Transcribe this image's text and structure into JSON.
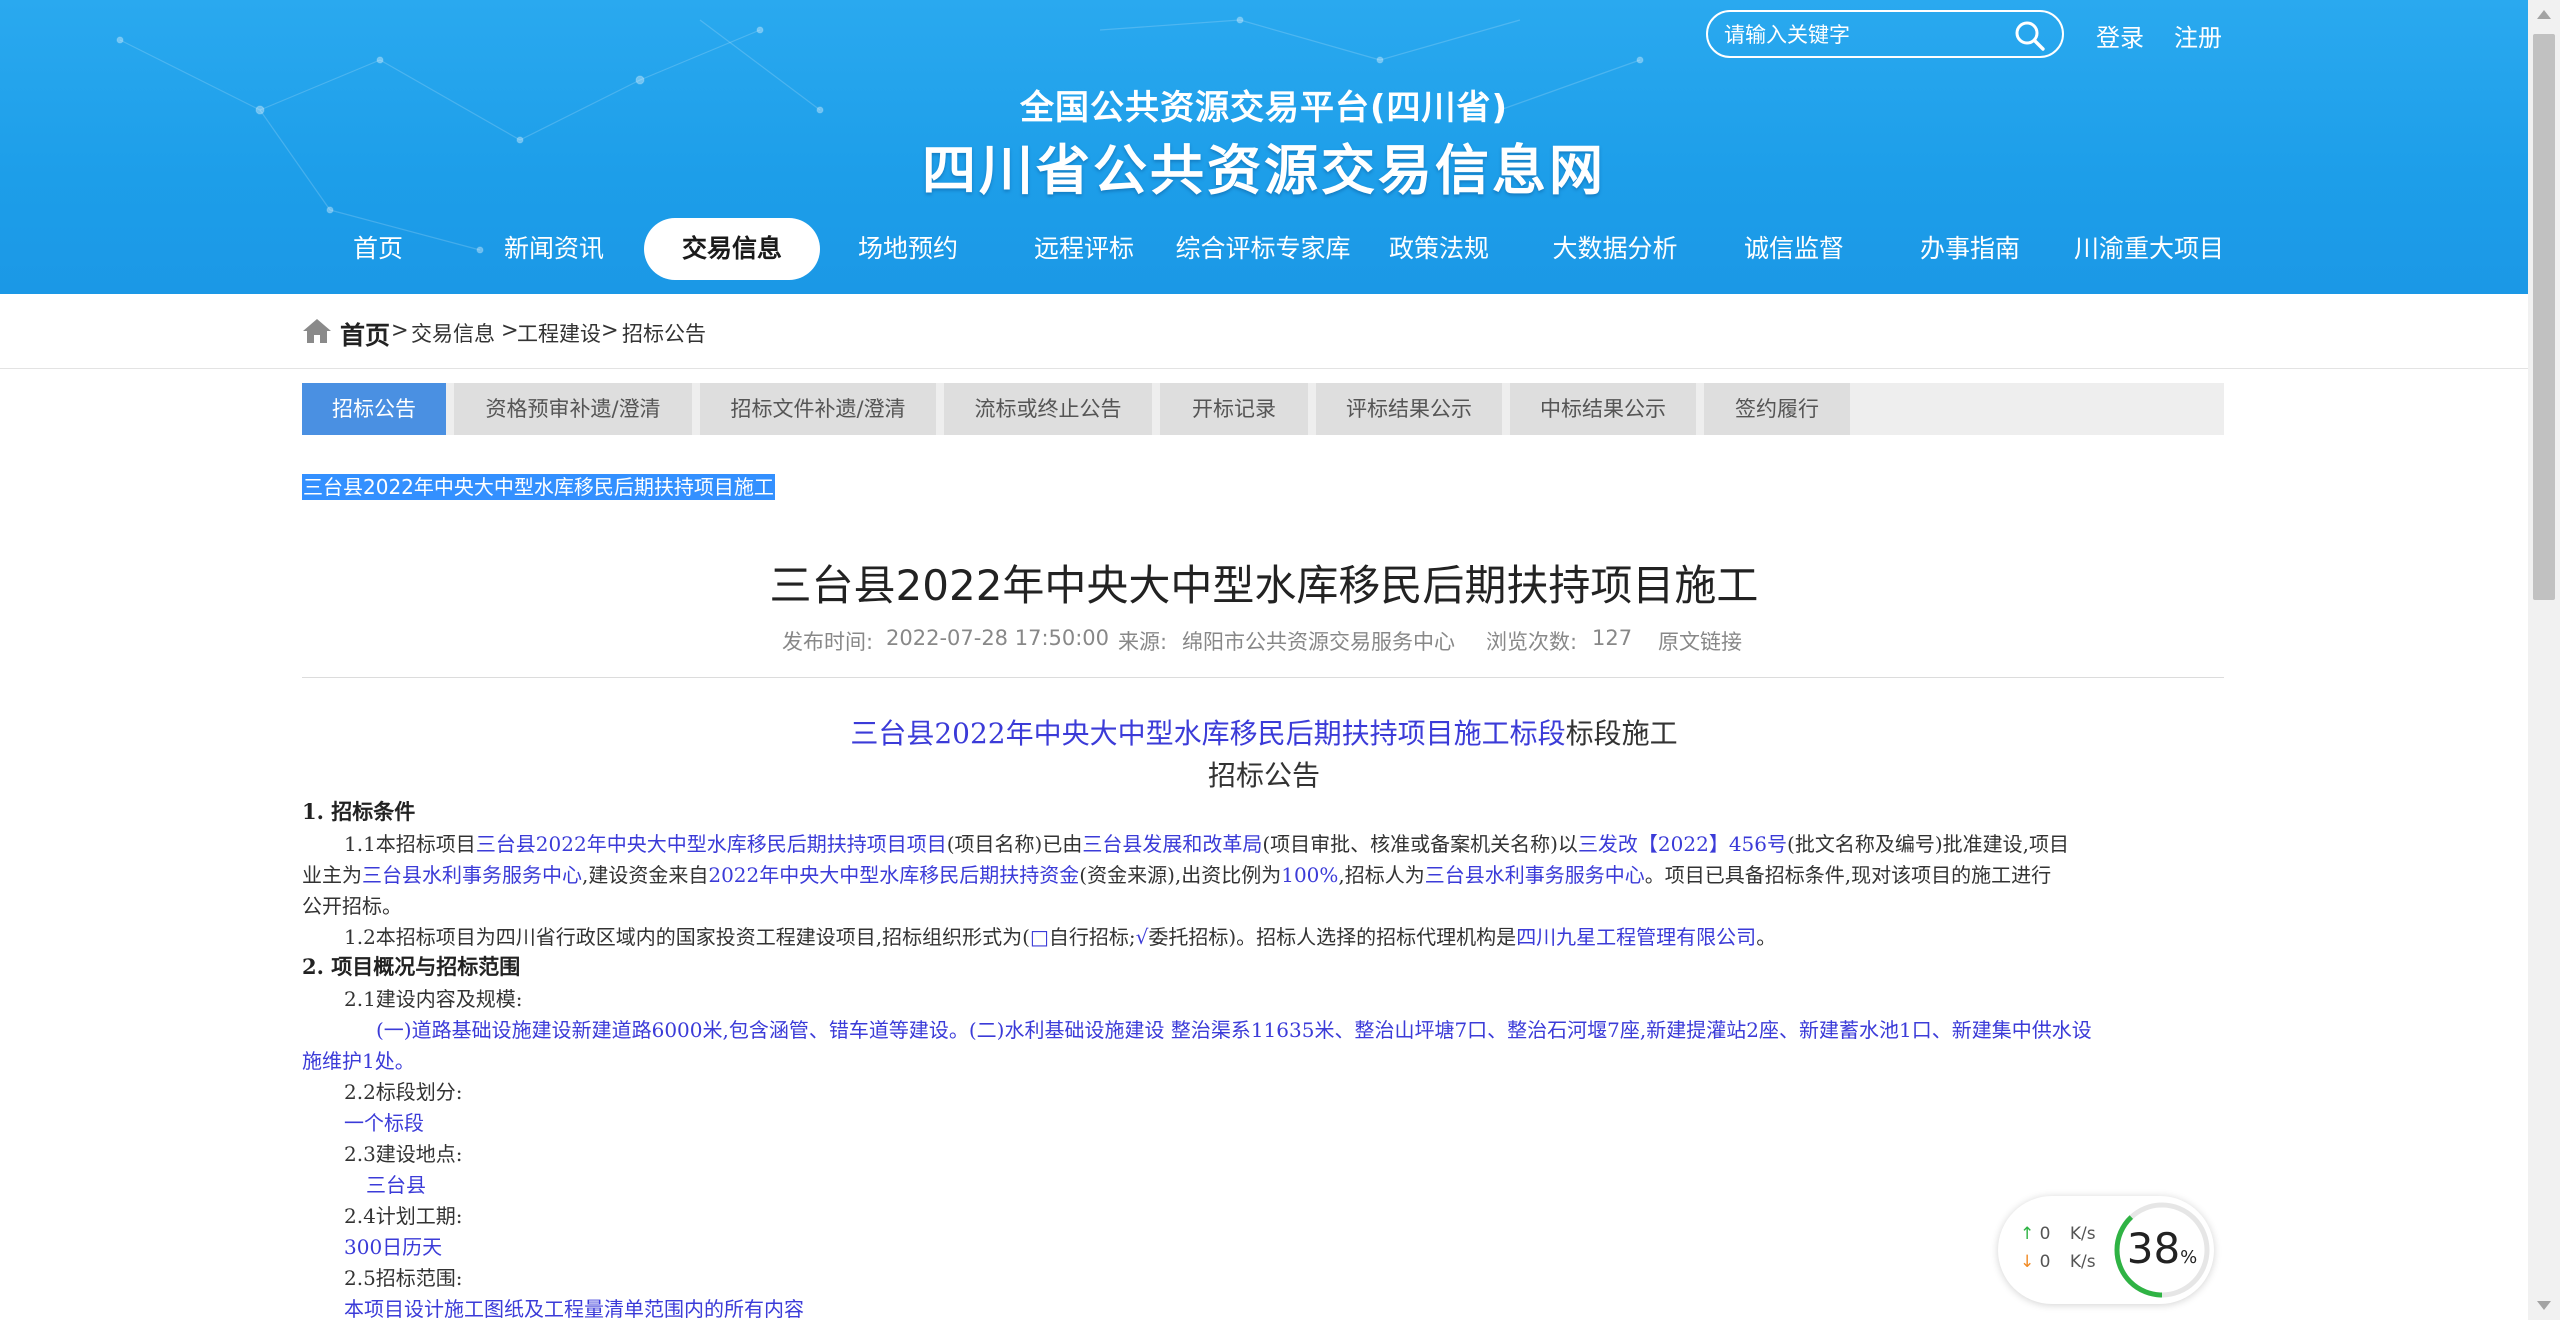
{
  "header": {
    "search": {
      "placeholder": "请输入关键字"
    },
    "login": "登录",
    "register": "注册",
    "subtitle": "全国公共资源交易平台(四川省)",
    "title": "四川省公共资源交易信息网"
  },
  "nav": {
    "items": [
      {
        "label": "首页",
        "active": false
      },
      {
        "label": "新闻资讯",
        "active": false
      },
      {
        "label": "交易信息",
        "active": true
      },
      {
        "label": "场地预约",
        "active": false
      },
      {
        "label": "远程评标",
        "active": false
      },
      {
        "label": "综合评标专家库",
        "active": false
      },
      {
        "label": "政策法规",
        "active": false
      },
      {
        "label": "大数据分析",
        "active": false
      },
      {
        "label": "诚信监督",
        "active": false
      },
      {
        "label": "办事指南",
        "active": false
      },
      {
        "label": "川渝重大项目",
        "active": false
      }
    ]
  },
  "breadcrumb": {
    "home": "首页",
    "sep": ">",
    "items": [
      "交易信息",
      "工程建设",
      "招标公告"
    ]
  },
  "tabs": {
    "items": [
      {
        "label": "招标公告",
        "active": true
      },
      {
        "label": "资格预审补遗/澄清",
        "active": false
      },
      {
        "label": "招标文件补遗/澄清",
        "active": false
      },
      {
        "label": "流标或终止公告",
        "active": false
      },
      {
        "label": "开标记录",
        "active": false
      },
      {
        "label": "评标结果公示",
        "active": false
      },
      {
        "label": "中标结果公示",
        "active": false
      },
      {
        "label": "签约履行",
        "active": false
      }
    ]
  },
  "article": {
    "highlight_title": "三台县2022年中央大中型水库移民后期扶持项目施工",
    "title": "三台县2022年中央大中型水库移民后期扶持项目施工",
    "meta": {
      "publish_label": "发布时间:",
      "publish_time": "2022-07-28 17:50:00",
      "source_label": "来源:",
      "source": "绵阳市公共资源交易服务中心",
      "views_label": "浏览次数:",
      "views": "127",
      "original_link": "原文链接"
    }
  },
  "content": {
    "heading_blue": "三台县2022年中央大中型水库移民后期扶持项目施工标段",
    "heading_black": "标段施工",
    "heading2": "招标公告",
    "s1": "1. 招标条件",
    "p11": {
      "a": "1.1本招标项目",
      "b": "三台县2022年中央大中型水库移民后期扶持项目项目",
      "c": "(项目名称)已由",
      "d": "三台县发展和改革局",
      "e": "(项目审批、核准或备案机关名称)以",
      "f": "三发改【2022】456号",
      "g": "(批文名称及编号)批准建设,项目",
      "h": "业主为",
      "i": "三台县水利事务服务中心",
      "j": ",建设资金来自",
      "k": "2022年中央大中型水库移民后期扶持资金",
      "l": "(资金来源),出资比例为",
      "m": "100%",
      "n": ",招标人为",
      "o": "三台县水利事务服务中心",
      "p": "。项目已具备招标条件,现对该项目的施工进行",
      "q": "公开招标。"
    },
    "p12": {
      "a": "1.2本招标项目为四川省行政区域内的国家投资工程建设项目,招标组织形式为(",
      "b": "□",
      "c": "自行招标;",
      "d": "√",
      "e": "委托招标)。招标人选择的招标代理机构是",
      "f": "四川九星工程管理有限公司",
      "g": "。"
    },
    "s2": "2. 项目概况与招标范围",
    "p21": "2.1建设内容及规模:",
    "p21_text1": "(一)道路基础设施建设新建道路6000米,包含涵管、错车道等建设。(二)水利基础设施建设 整治渠系11635米、整治山坪塘7口、整治石河堰7座,新建提灌站2座、新建蓄水池1口、新建集中供水设",
    "p21_text2": "施维护1处。",
    "p22": "2.2标段划分:",
    "p22_val": "一个标段",
    "p23": "2.3建设地点:",
    "p23_val": "三台县",
    "p24": "2.4计划工期:",
    "p24_val": "300日历天",
    "p25": "2.5招标范围:",
    "p25_val": "本项目设计施工图纸及工程量清单范围内的所有内容"
  },
  "speed_widget": {
    "up_value": "0",
    "up_unit": "K/s",
    "down_value": "0",
    "down_unit": "K/s",
    "percent": "38",
    "percent_sign": "%",
    "up_color": "#2fb344",
    "down_color": "#f08a24",
    "gauge_color": "#2fb344"
  },
  "colors": {
    "header_blue": "#1d9ee9",
    "tab_active": "#4a90e2",
    "link_blue": "#3b3bd8"
  }
}
